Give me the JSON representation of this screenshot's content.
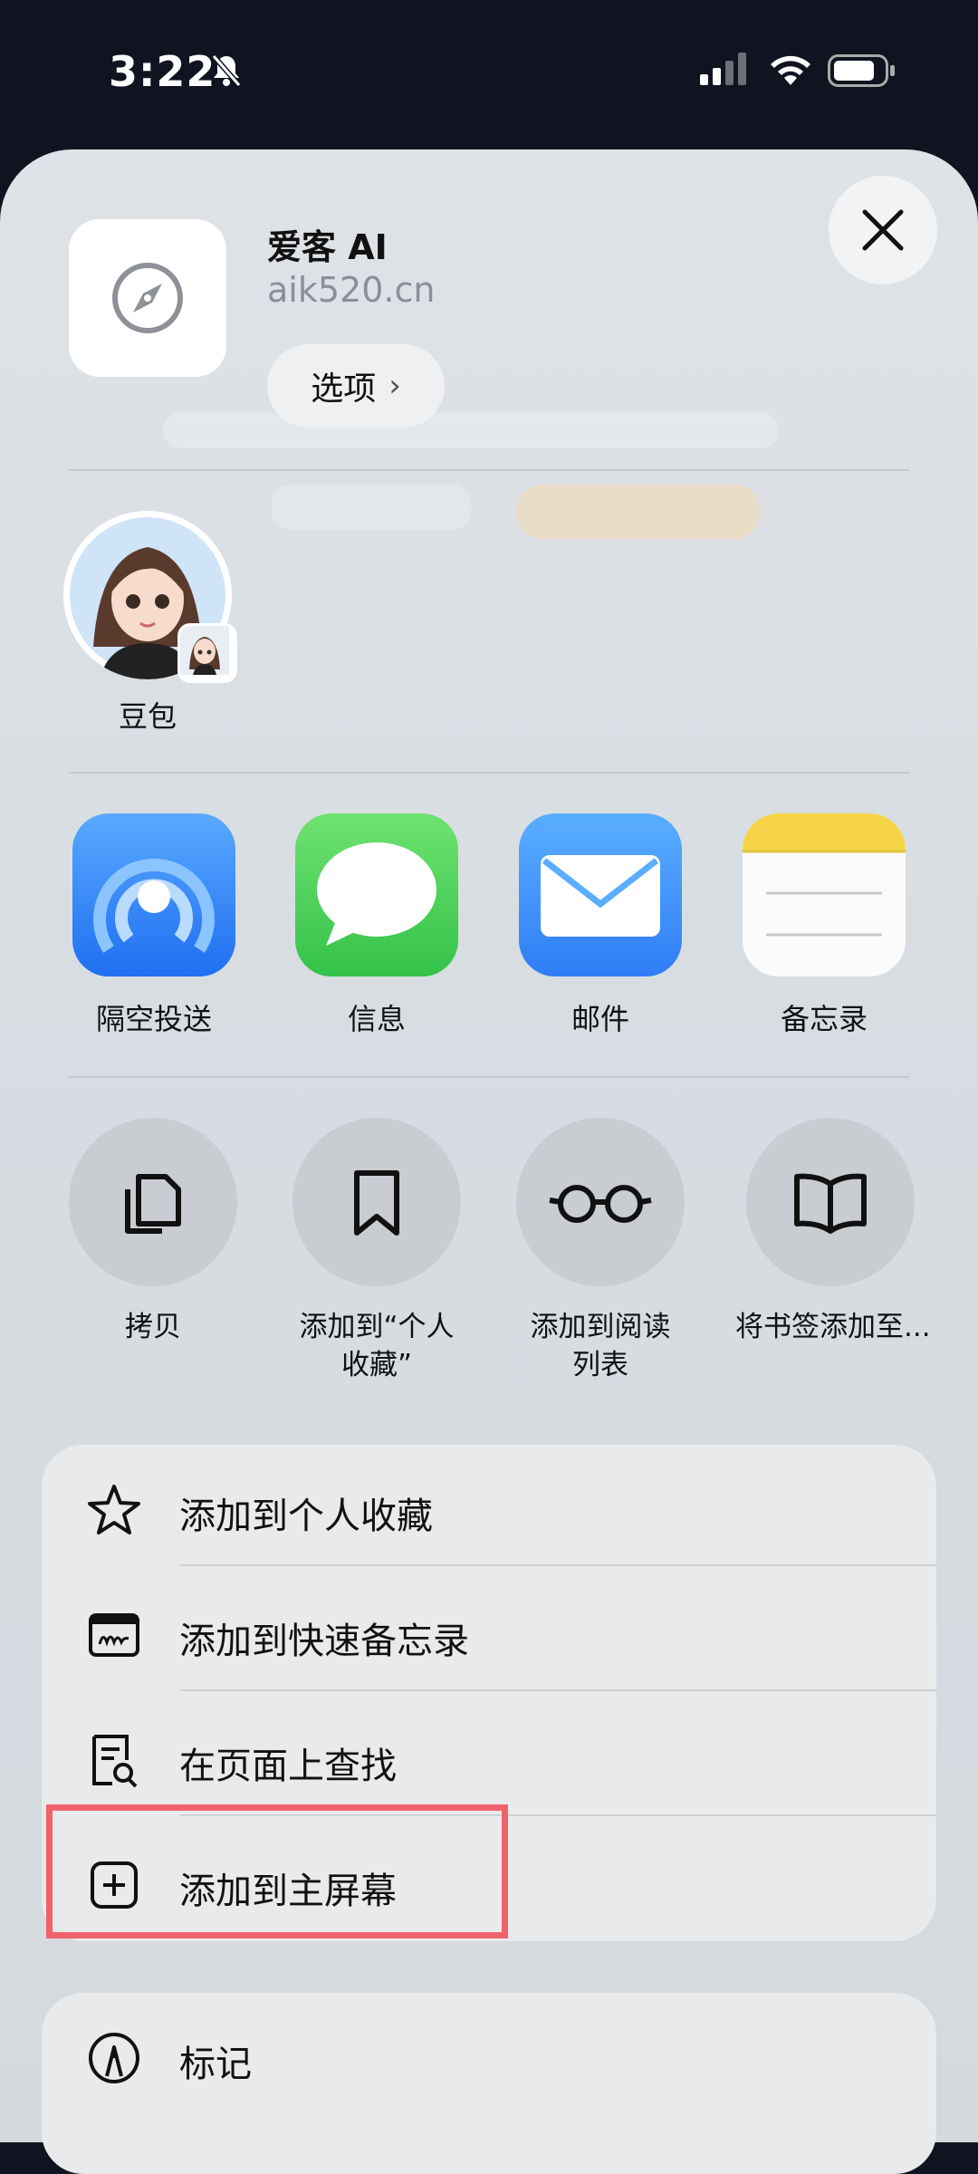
{
  "status": {
    "time": "3:22"
  },
  "header": {
    "site_title": "爱客 AI",
    "site_domain": "aik520.cn",
    "options_label": "选项",
    "options_chevron": "›"
  },
  "contacts": [
    {
      "name": "豆包"
    }
  ],
  "apps": [
    {
      "label": "隔空投送",
      "icon": "airdrop-icon"
    },
    {
      "label": "信息",
      "icon": "messages-icon"
    },
    {
      "label": "邮件",
      "icon": "mail-icon"
    },
    {
      "label": "备忘录",
      "icon": "notes-icon"
    }
  ],
  "actions": [
    {
      "label": "拷贝",
      "icon": "copy-icon"
    },
    {
      "label": "添加到“个人\n收藏”",
      "icon": "bookmark-icon"
    },
    {
      "label": "添加到阅读\n列表",
      "icon": "glasses-icon"
    },
    {
      "label": "将书签添加至...",
      "icon": "book-icon"
    }
  ],
  "menu": [
    {
      "label": "添加到个人收藏",
      "icon": "star-icon"
    },
    {
      "label": "添加到快速备忘录",
      "icon": "quick-note-icon"
    },
    {
      "label": "在页面上查找",
      "icon": "find-on-page-icon"
    },
    {
      "label": "添加到主屏幕",
      "icon": "add-square-icon"
    }
  ],
  "menu2": [
    {
      "label": "标记",
      "icon": "markup-icon"
    }
  ],
  "colors": {
    "highlight": "#f0626b",
    "airdrop": "#2f7df6",
    "messages": "#4cd964",
    "mail": "#3b8ff7",
    "notes_header": "#f5d547"
  }
}
